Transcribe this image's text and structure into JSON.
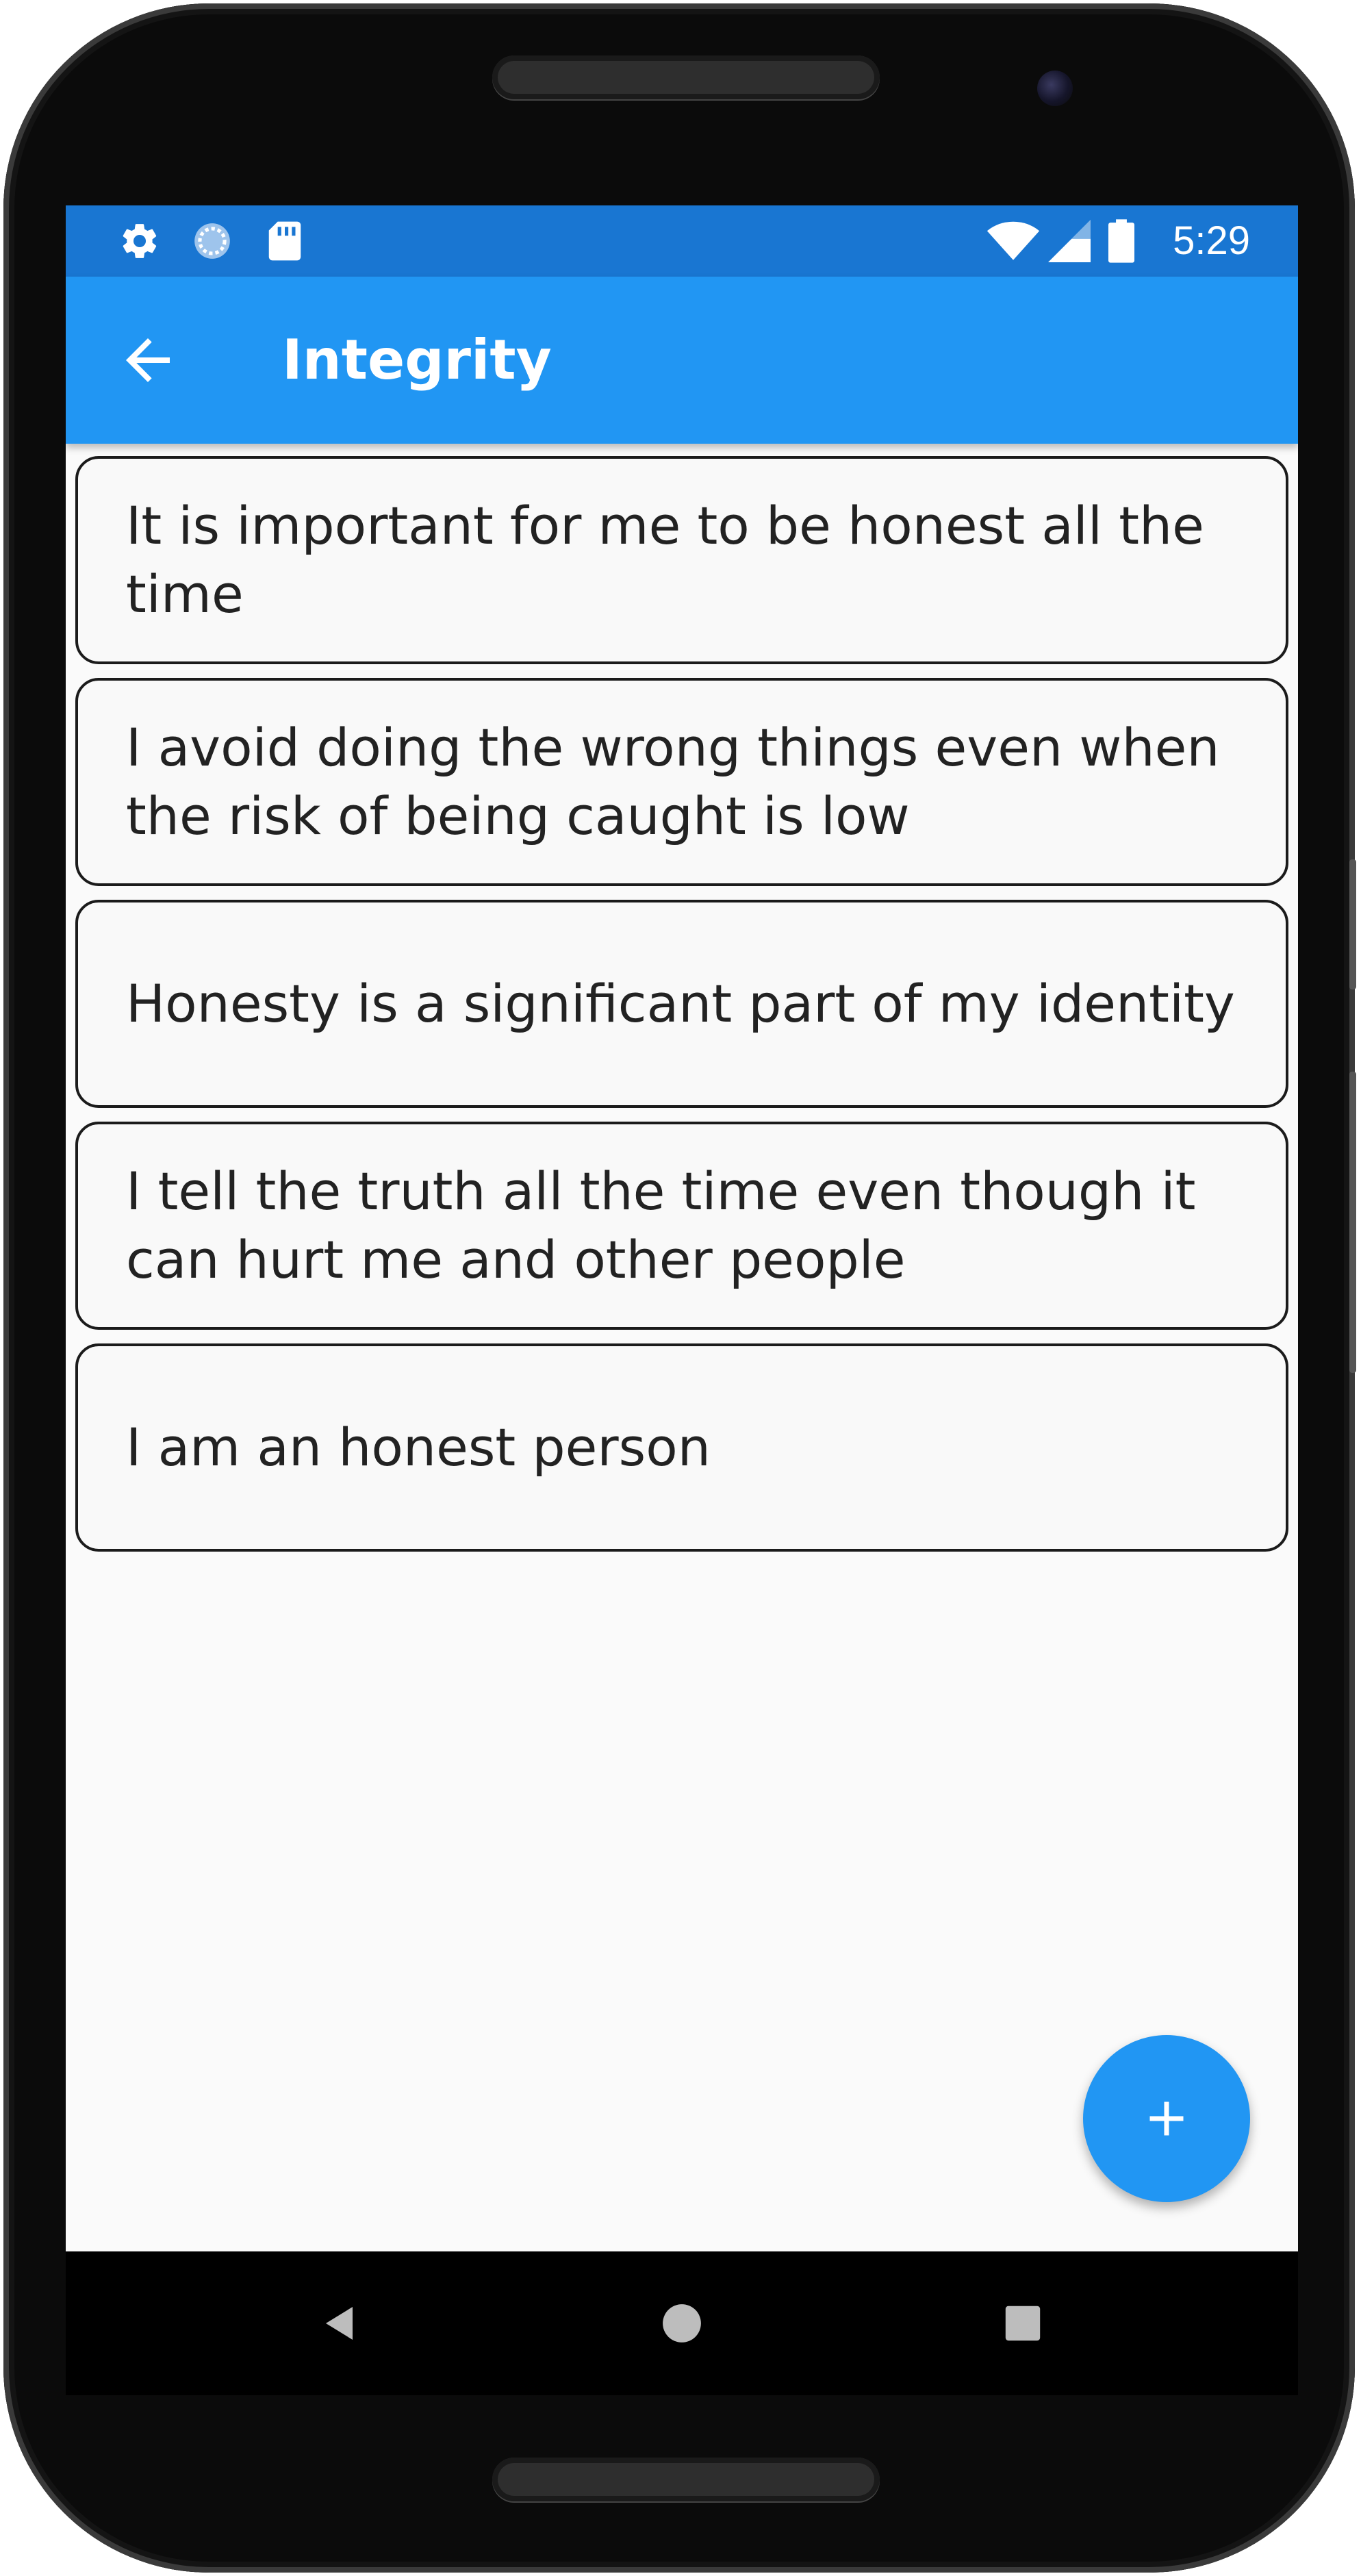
{
  "status_bar": {
    "icons": [
      "settings-icon",
      "sync-icon",
      "sd-card-icon",
      "wifi-icon",
      "signal-icon",
      "battery-icon"
    ],
    "time": "5:29",
    "color": "#1976d2"
  },
  "app_bar": {
    "title": "Integrity",
    "back_icon": "arrow-back-icon",
    "color": "#2196f3"
  },
  "statements": [
    {
      "text": "It is important for me to be honest all the time"
    },
    {
      "text": "I avoid doing the wrong things even when the risk of being caught is low"
    },
    {
      "text": "Honesty is a significant part of my identity"
    },
    {
      "text": "I tell the truth all the time even though it can hurt me and other people"
    },
    {
      "text": "I am an honest person"
    }
  ],
  "fab": {
    "icon": "plus-icon",
    "color": "#2196f3"
  },
  "nav_bar": {
    "icons": [
      "back-triangle-icon",
      "home-circle-icon",
      "recents-square-icon"
    ]
  }
}
